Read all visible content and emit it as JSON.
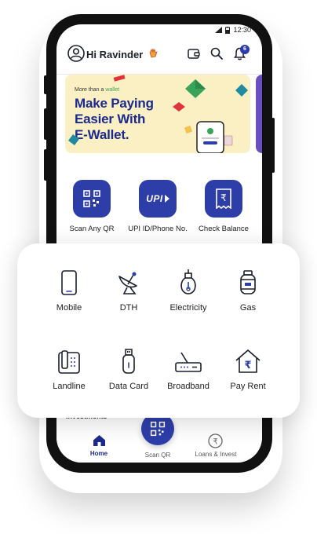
{
  "status_bar": {
    "time": "12:30"
  },
  "header": {
    "greeting": "Hi Ravinder",
    "notification_count": "6"
  },
  "banner": {
    "small_text_prefix": "More than a",
    "small_text_highlight": "wallet",
    "title_line1": "Make Paying",
    "title_line2": "Easier With",
    "title_line3": "E-Wallet."
  },
  "quick_actions": [
    {
      "label": "Scan Any QR",
      "icon": "qr-code-icon"
    },
    {
      "label": "UPI ID/Phone No.",
      "icon": "upi-icon",
      "icon_text": "UPI"
    },
    {
      "label": "Check Balance",
      "icon": "rupee-receipt-icon"
    }
  ],
  "services": [
    {
      "label": "Mobile",
      "icon": "mobile-icon"
    },
    {
      "label": "DTH",
      "icon": "satellite-dish-icon"
    },
    {
      "label": "Electricity",
      "icon": "bulb-icon"
    },
    {
      "label": "Gas",
      "icon": "gas-cylinder-icon"
    },
    {
      "label": "Landline",
      "icon": "landline-icon"
    },
    {
      "label": "Data Card",
      "icon": "usb-icon"
    },
    {
      "label": "Broadband",
      "icon": "router-icon"
    },
    {
      "label": "Pay Rent",
      "icon": "house-rupee-icon"
    }
  ],
  "section_peek": "Investments",
  "bottom_nav": [
    {
      "label": "Home",
      "icon": "home-icon",
      "active": true
    },
    {
      "label": "Scan QR",
      "icon": "qr-code-icon",
      "active": false
    },
    {
      "label": "Loans & Invest",
      "icon": "rupee-coin-icon",
      "active": false
    }
  ],
  "colors": {
    "brand": "#2d3ea9",
    "banner_bg": "#faf0c4",
    "active_nav": "#1b2a8c"
  }
}
